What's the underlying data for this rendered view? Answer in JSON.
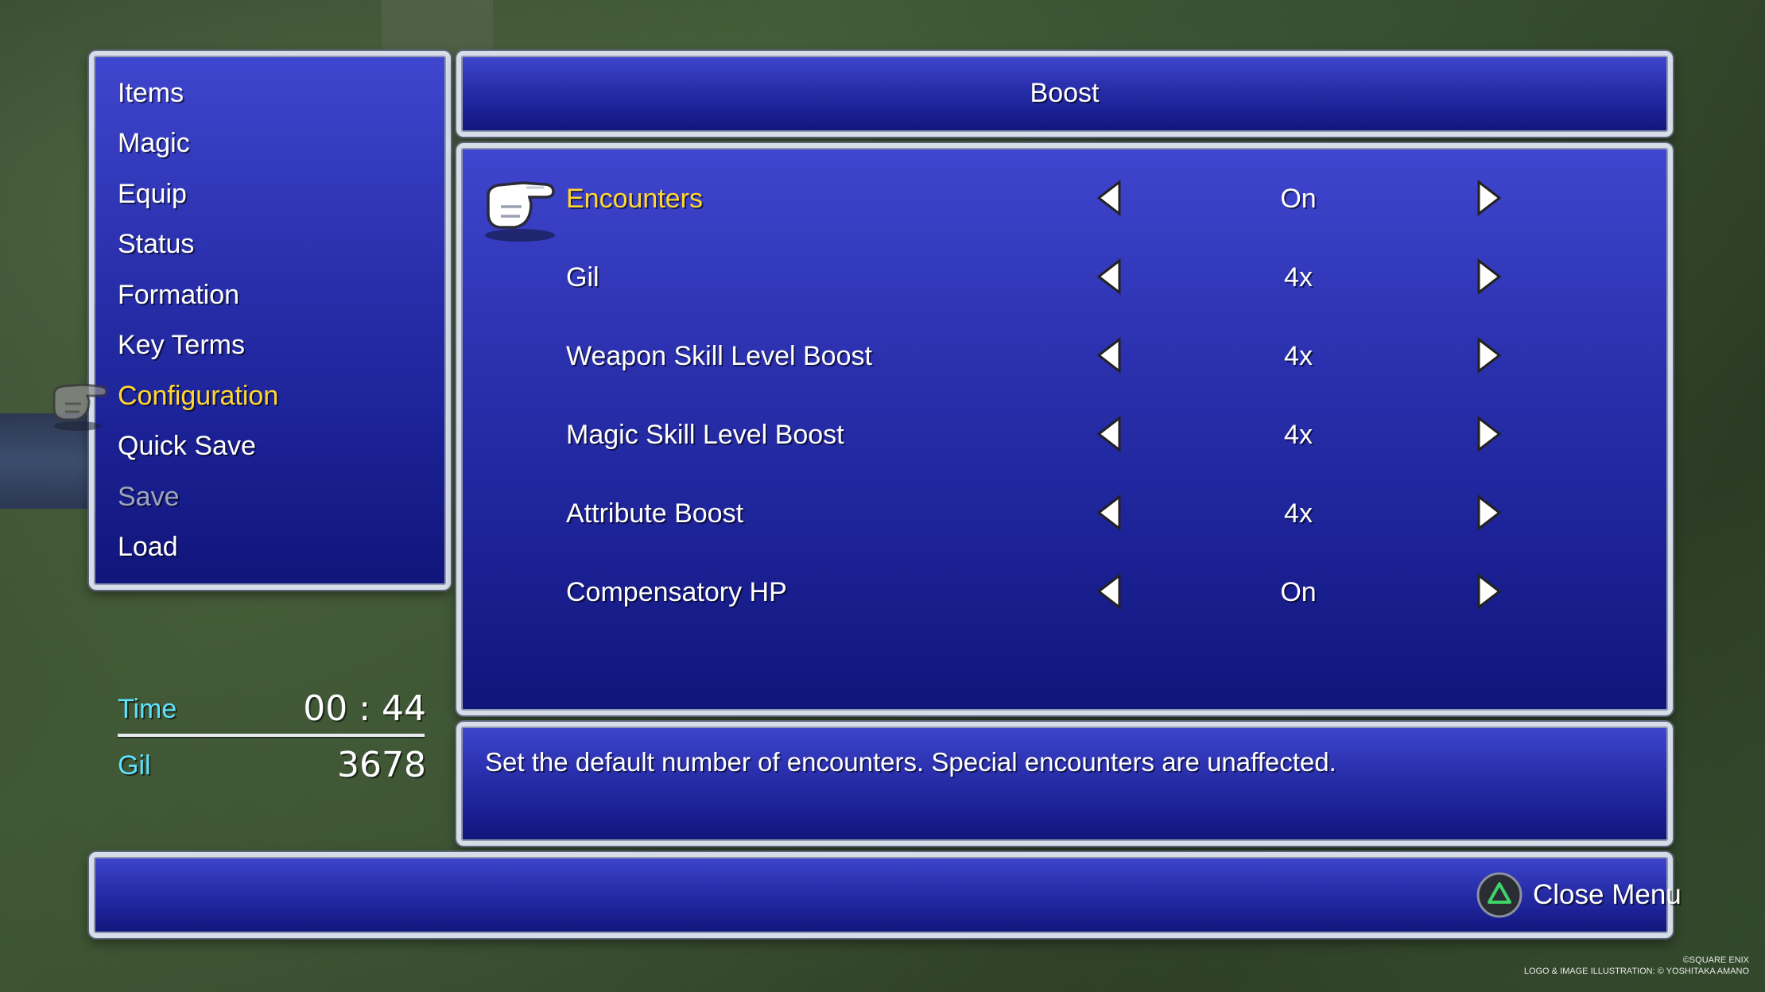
{
  "menu": {
    "items": [
      {
        "label": "Items"
      },
      {
        "label": "Magic"
      },
      {
        "label": "Equip"
      },
      {
        "label": "Status"
      },
      {
        "label": "Formation"
      },
      {
        "label": "Key Terms"
      },
      {
        "label": "Configuration",
        "selected": true
      },
      {
        "label": "Quick Save"
      },
      {
        "label": "Save",
        "disabled": true
      },
      {
        "label": "Load"
      }
    ]
  },
  "stats": {
    "time_label": "Time",
    "time_value": "00 : 44",
    "gil_label": "Gil",
    "gil_value": "3678"
  },
  "config": {
    "title": "Boost",
    "options": [
      {
        "label": "Encounters",
        "value": "On",
        "selected": true
      },
      {
        "label": "Gil",
        "value": "4x"
      },
      {
        "label": "Weapon Skill Level Boost",
        "value": "4x"
      },
      {
        "label": "Magic Skill Level Boost",
        "value": "4x"
      },
      {
        "label": "Attribute Boost",
        "value": "4x"
      },
      {
        "label": "Compensatory HP",
        "value": "On"
      }
    ],
    "description": "Set the default number of encounters. Special encounters are unaffected."
  },
  "footer": {
    "close_label": "Close Menu",
    "close_icon": "triangle-button-icon"
  },
  "copyright": {
    "line1": "©SQUARE ENIX",
    "line2": "LOGO & IMAGE ILLUSTRATION: © YOSHITAKA AMANO"
  },
  "colors": {
    "highlight": "#ffd632",
    "accent": "#5fe2ff",
    "panel": "#2c32b0"
  }
}
